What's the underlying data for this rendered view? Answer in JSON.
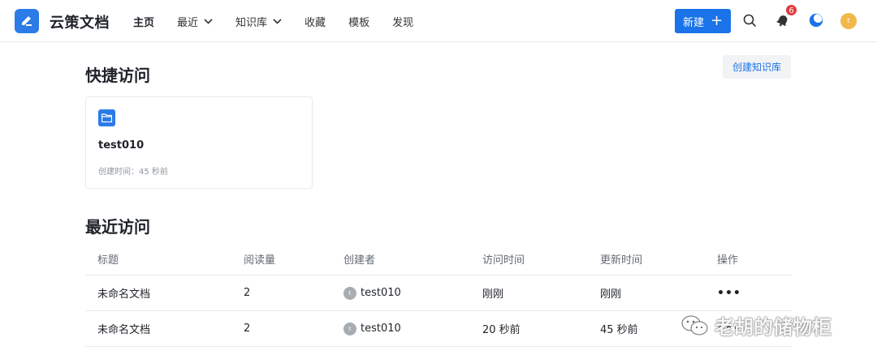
{
  "app": {
    "name": "云策文档"
  },
  "nav": {
    "items": [
      {
        "label": "主页"
      },
      {
        "label": "最近"
      },
      {
        "label": "知识库"
      },
      {
        "label": "收藏"
      },
      {
        "label": "模板"
      },
      {
        "label": "发现"
      }
    ]
  },
  "header": {
    "new_button": "新建",
    "notification_count": "6",
    "avatar_initial": "t"
  },
  "quick_access": {
    "title": "快捷访问",
    "create_button": "创建知识库",
    "cards": [
      {
        "title": "test010",
        "subtitle": "创建时间：45 秒前"
      }
    ]
  },
  "recent": {
    "title": "最近访问",
    "columns": [
      "标题",
      "阅读量",
      "创建者",
      "访问时间",
      "更新时间",
      "操作"
    ],
    "rows": [
      {
        "title": "未命名文档",
        "reads": "2",
        "creator": "test010",
        "creator_initial": "t",
        "visited": "刚刚",
        "updated": "刚刚",
        "action": "•••"
      },
      {
        "title": "未命名文档",
        "reads": "2",
        "creator": "test010",
        "creator_initial": "t",
        "visited": "20 秒前",
        "updated": "45 秒前",
        "action": "•••"
      }
    ]
  },
  "watermark": {
    "text": "老胡的储物柜"
  },
  "colors": {
    "accent": "#1a73e8",
    "badge": "#e4393c",
    "avatar": "#f1b94b"
  }
}
